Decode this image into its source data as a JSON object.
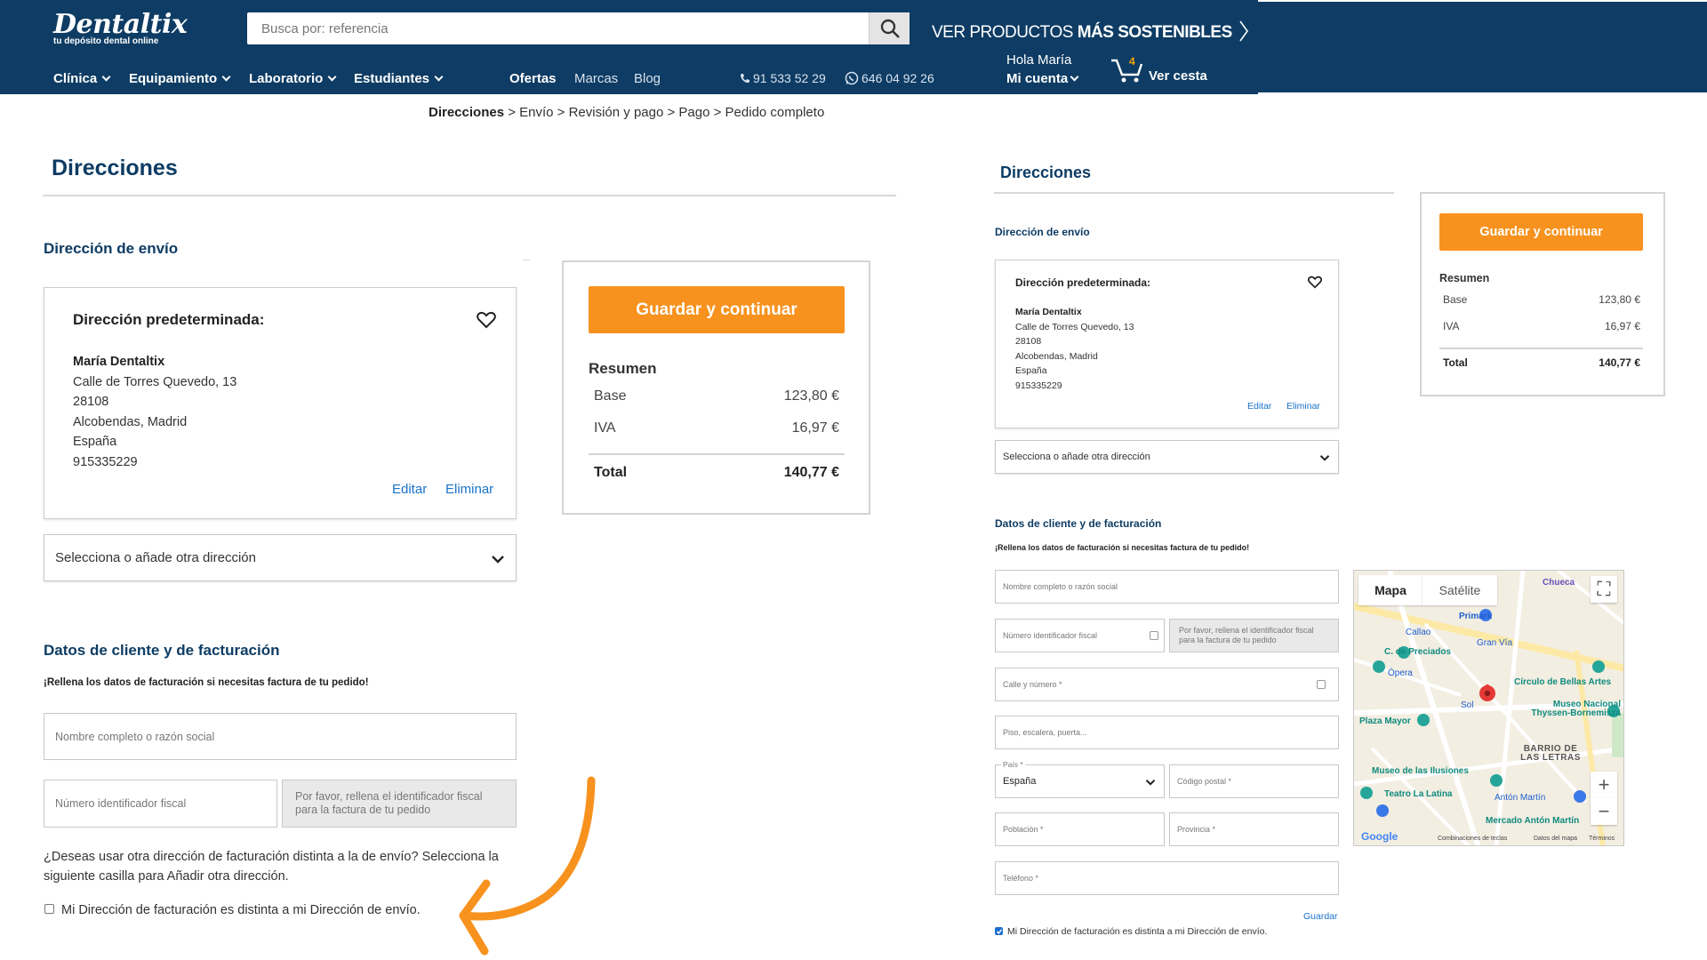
{
  "header": {
    "logo_name": "Dentaltix",
    "logo_tagline": "tu depósito dental online",
    "search_placeholder": "Busca por: referencia",
    "promo_light": "VER PRODUCTOS",
    "promo_bold": "MÁS SOSTENIBLES",
    "nav": [
      "Clínica",
      "Equipamiento",
      "Laboratorio",
      "Estudiantes"
    ],
    "nav_links": [
      "Ofertas",
      "Marcas",
      "Blog"
    ],
    "phone": "91 533 52 29",
    "whatsapp": "646 04 92 26",
    "greeting": "Hola María",
    "account": "Mi cuenta",
    "cart_count": "4",
    "cart_label": "Ver cesta"
  },
  "breadcrumb": {
    "current": "Direcciones",
    "rest": " > Envío > Revisión y pago > Pago > Pedido completo"
  },
  "page": {
    "title": "Direcciones",
    "shipping_heading": "Dirección de envío",
    "default_address_title": "Dirección predeterminada:",
    "address": {
      "name": "María Dentaltix",
      "street": "Calle de Torres Quevedo, 13",
      "zip": "28108",
      "city": "Alcobendas, Madrid",
      "country": "España",
      "phone": "915335229"
    },
    "edit": "Editar",
    "delete": "Eliminar",
    "select_other": "Selecciona o añade otra dirección",
    "billing_heading": "Datos de cliente y de facturación",
    "billing_note": "¡Rellena los datos de facturación si necesitas factura de tu pedido!",
    "field_name": "Nombre completo o razón social",
    "field_tax_id": "Número identificador fiscal",
    "tax_hint": "Por favor, rellena el identificador fiscal para la factura de tu pedido",
    "question": "¿Deseas usar otra dirección de facturación distinta a la de envío? Selecciona la siguiente casilla para Añadir otra dirección.",
    "checkbox_label": "Mi Dirección de facturación es distinta a mi Dirección de envío.",
    "field_street": "Calle y número *",
    "field_floor": "Piso, escalera, puerta...",
    "field_country_label": "País *",
    "field_country_value": "España",
    "field_postal": "Código postal *",
    "field_town": "Población *",
    "field_province": "Provincia *",
    "field_phone": "Teléfono *",
    "save": "Guardar"
  },
  "summary": {
    "button": "Guardar y continuar",
    "heading": "Resumen",
    "base_label": "Base",
    "base_value": "123,80 €",
    "tax_label": "IVA",
    "tax_value": "16,97 €",
    "total_label": "Total",
    "total_value": "140,77 €"
  },
  "map": {
    "tab_map": "Mapa",
    "tab_satellite": "Satélite",
    "labels": [
      "Chueca",
      "Primark",
      "Callao",
      "Gran Vía",
      "C. de Preciados",
      "Ópera",
      "Círculo de Bellas Artes",
      "Sol",
      "Museo Nacional Thyssen-Bornemisza",
      "Plaza Mayor",
      "BARRIO DE LAS LETRAS",
      "Museo de las Ilusiones",
      "Teatro La Latina",
      "Antón Martín",
      "Mercado Antón Martín",
      "Google",
      "Combinaciones de teclas",
      "Datos del mapa",
      "Términos"
    ]
  },
  "colors": {
    "header_bg": "#0e3c64",
    "accent_orange": "#f7921e",
    "link_blue": "#1a73c9",
    "arrow_orange": "#f7921e"
  }
}
